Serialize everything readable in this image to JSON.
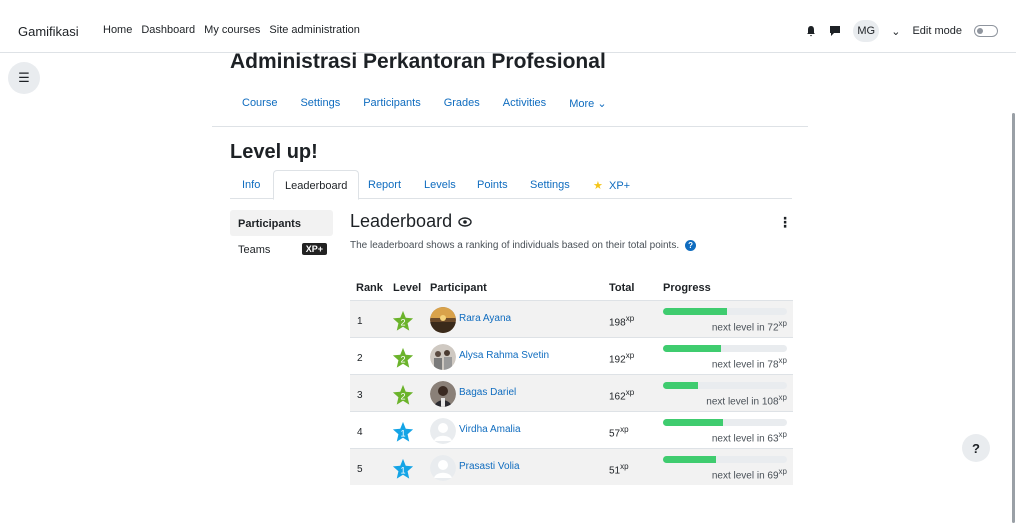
{
  "topbar": {
    "brand": "Gamifikasi",
    "nav": [
      "Home",
      "Dashboard",
      "My courses",
      "Site administration"
    ],
    "user_initials": "MG",
    "edit_mode_label": "Edit mode"
  },
  "course": {
    "title": "Administrasi Perkantoran Profesional",
    "nav": [
      "Course",
      "Settings",
      "Participants",
      "Grades",
      "Activities",
      "More"
    ]
  },
  "page": {
    "heading": "Level up!",
    "tabs": [
      "Info",
      "Leaderboard",
      "Report",
      "Levels",
      "Points",
      "Settings",
      "XP+"
    ],
    "active_tab": "Leaderboard"
  },
  "side_nav": {
    "items": [
      "Participants",
      "Teams"
    ],
    "teams_badge": "XP+"
  },
  "leaderboard": {
    "title": "Leaderboard",
    "description": "The leaderboard shows a ranking of individuals based on their total points.",
    "columns": [
      "Rank",
      "Level",
      "Participant",
      "Total",
      "Progress"
    ],
    "xp_unit": "xp",
    "next_prefix": "next level in",
    "rows": [
      {
        "rank": "1",
        "level": "2",
        "name": "Rara Ayana",
        "total": "198",
        "next": "72",
        "progress": 0.52,
        "star_color": "#6bb32b",
        "avatar": "photo-sunset"
      },
      {
        "rank": "2",
        "level": "2",
        "name": "Alysa Rahma Svetin",
        "total": "192",
        "next": "78",
        "progress": 0.47,
        "star_color": "#6bb32b",
        "avatar": "photo-group"
      },
      {
        "rank": "3",
        "level": "2",
        "name": "Bagas Dariel",
        "total": "162",
        "next": "108",
        "progress": 0.28,
        "star_color": "#6bb32b",
        "avatar": "photo-person"
      },
      {
        "rank": "4",
        "level": "1",
        "name": "Virdha Amalia",
        "total": "57",
        "next": "63",
        "progress": 0.48,
        "star_color": "#14a4e6",
        "avatar": "default"
      },
      {
        "rank": "5",
        "level": "1",
        "name": "Prasasti Volia",
        "total": "51",
        "next": "69",
        "progress": 0.43,
        "star_color": "#14a4e6",
        "avatar": "default"
      }
    ]
  },
  "colors": {
    "link": "#0f6cbf",
    "progress": "#3fcc6f",
    "level1": "#14a4e6",
    "level2": "#6bb32b"
  },
  "help_button": "?"
}
